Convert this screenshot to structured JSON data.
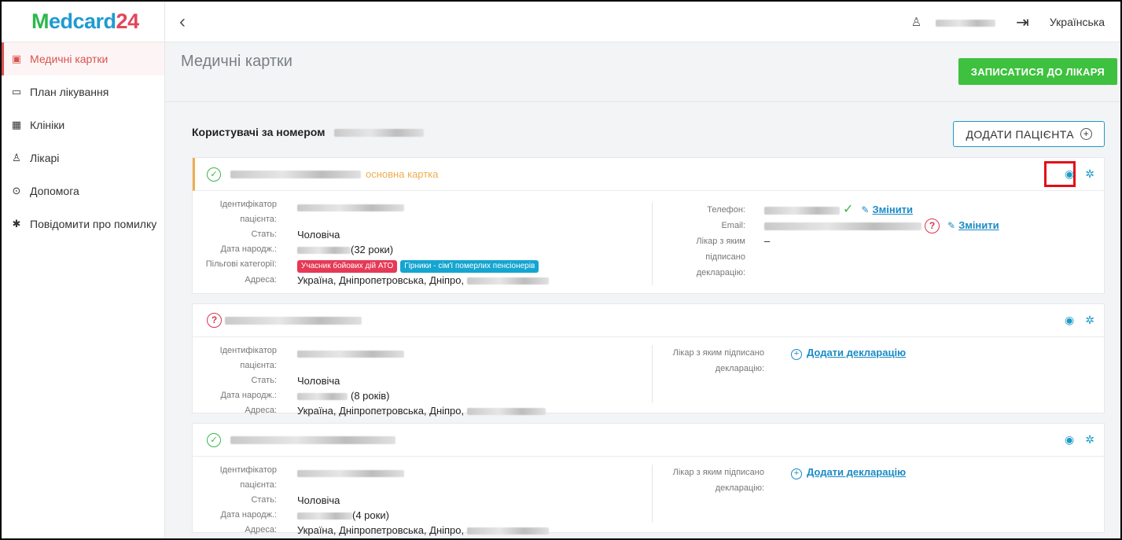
{
  "logo": {
    "m": "M",
    "rest": "edcard",
    "num": "24"
  },
  "sidebar": {
    "items": [
      {
        "label": "Медичні картки",
        "icon": "id-card-icon",
        "glyph": "▣"
      },
      {
        "label": "План лікування",
        "icon": "calendar-icon",
        "glyph": "▭"
      },
      {
        "label": "Клініки",
        "icon": "hospital-icon",
        "glyph": "▦"
      },
      {
        "label": "Лікарі",
        "icon": "doctor-icon",
        "glyph": "♙"
      },
      {
        "label": "Допомога",
        "icon": "help-icon",
        "glyph": "⊙"
      },
      {
        "label": "Повідомити про помилку",
        "icon": "bug-icon",
        "glyph": "✱"
      }
    ]
  },
  "topbar": {
    "back": "‹",
    "language": "Українська"
  },
  "page": {
    "title": "Медичні картки",
    "book_button": "ЗАПИСАТИСЯ ДО ЛІКАРЯ",
    "users_title": "Користувачі за номером",
    "add_patient_button": "ДОДАТИ ПАЦІЄНТА"
  },
  "labels": {
    "patient_id": "Ідентифікатор пацієнта:",
    "patient_id_1": "Ідентифікатор",
    "patient_id_2": "пацієнта:",
    "sex": "Стать:",
    "birth": "Дата народж.:",
    "benefits": "Пільгові категорії:",
    "address": "Адреса:",
    "phone": "Телефон:",
    "email": "Email:",
    "doctor_decl_1": "Лікар з яким",
    "doctor_decl_2": "підписано",
    "doctor_decl_3": "декларацію:",
    "doctor_decl_a": "Лікар з яким підписано",
    "doctor_decl_b": "декларацію:",
    "change": "Змінити",
    "add_declaration": "Додати декларацію"
  },
  "cards": [
    {
      "status": "verified",
      "main_tag": "основна картка",
      "sex": "Чоловіча",
      "age": "(32 роки)",
      "benefits": [
        "Учасник бойових дій АТО",
        "Гірники - сім'ї померлих пенсіонерів"
      ],
      "address": "Україна, Дніпропетровська, Дніпро,",
      "doctor": "–"
    },
    {
      "status": "unverified",
      "sex": "Чоловіча",
      "age": "(8 років)",
      "address": "Україна, Дніпропетровська, Дніпро,"
    },
    {
      "status": "verified",
      "sex": "Чоловіча",
      "age": "(4 роки)",
      "address": "Україна, Дніпропетровська, Дніпро,"
    }
  ],
  "colors": {
    "accent": "#1a9bc7",
    "green": "#3ec13e",
    "red": "#e20d18",
    "orange": "#f0ad4e"
  }
}
